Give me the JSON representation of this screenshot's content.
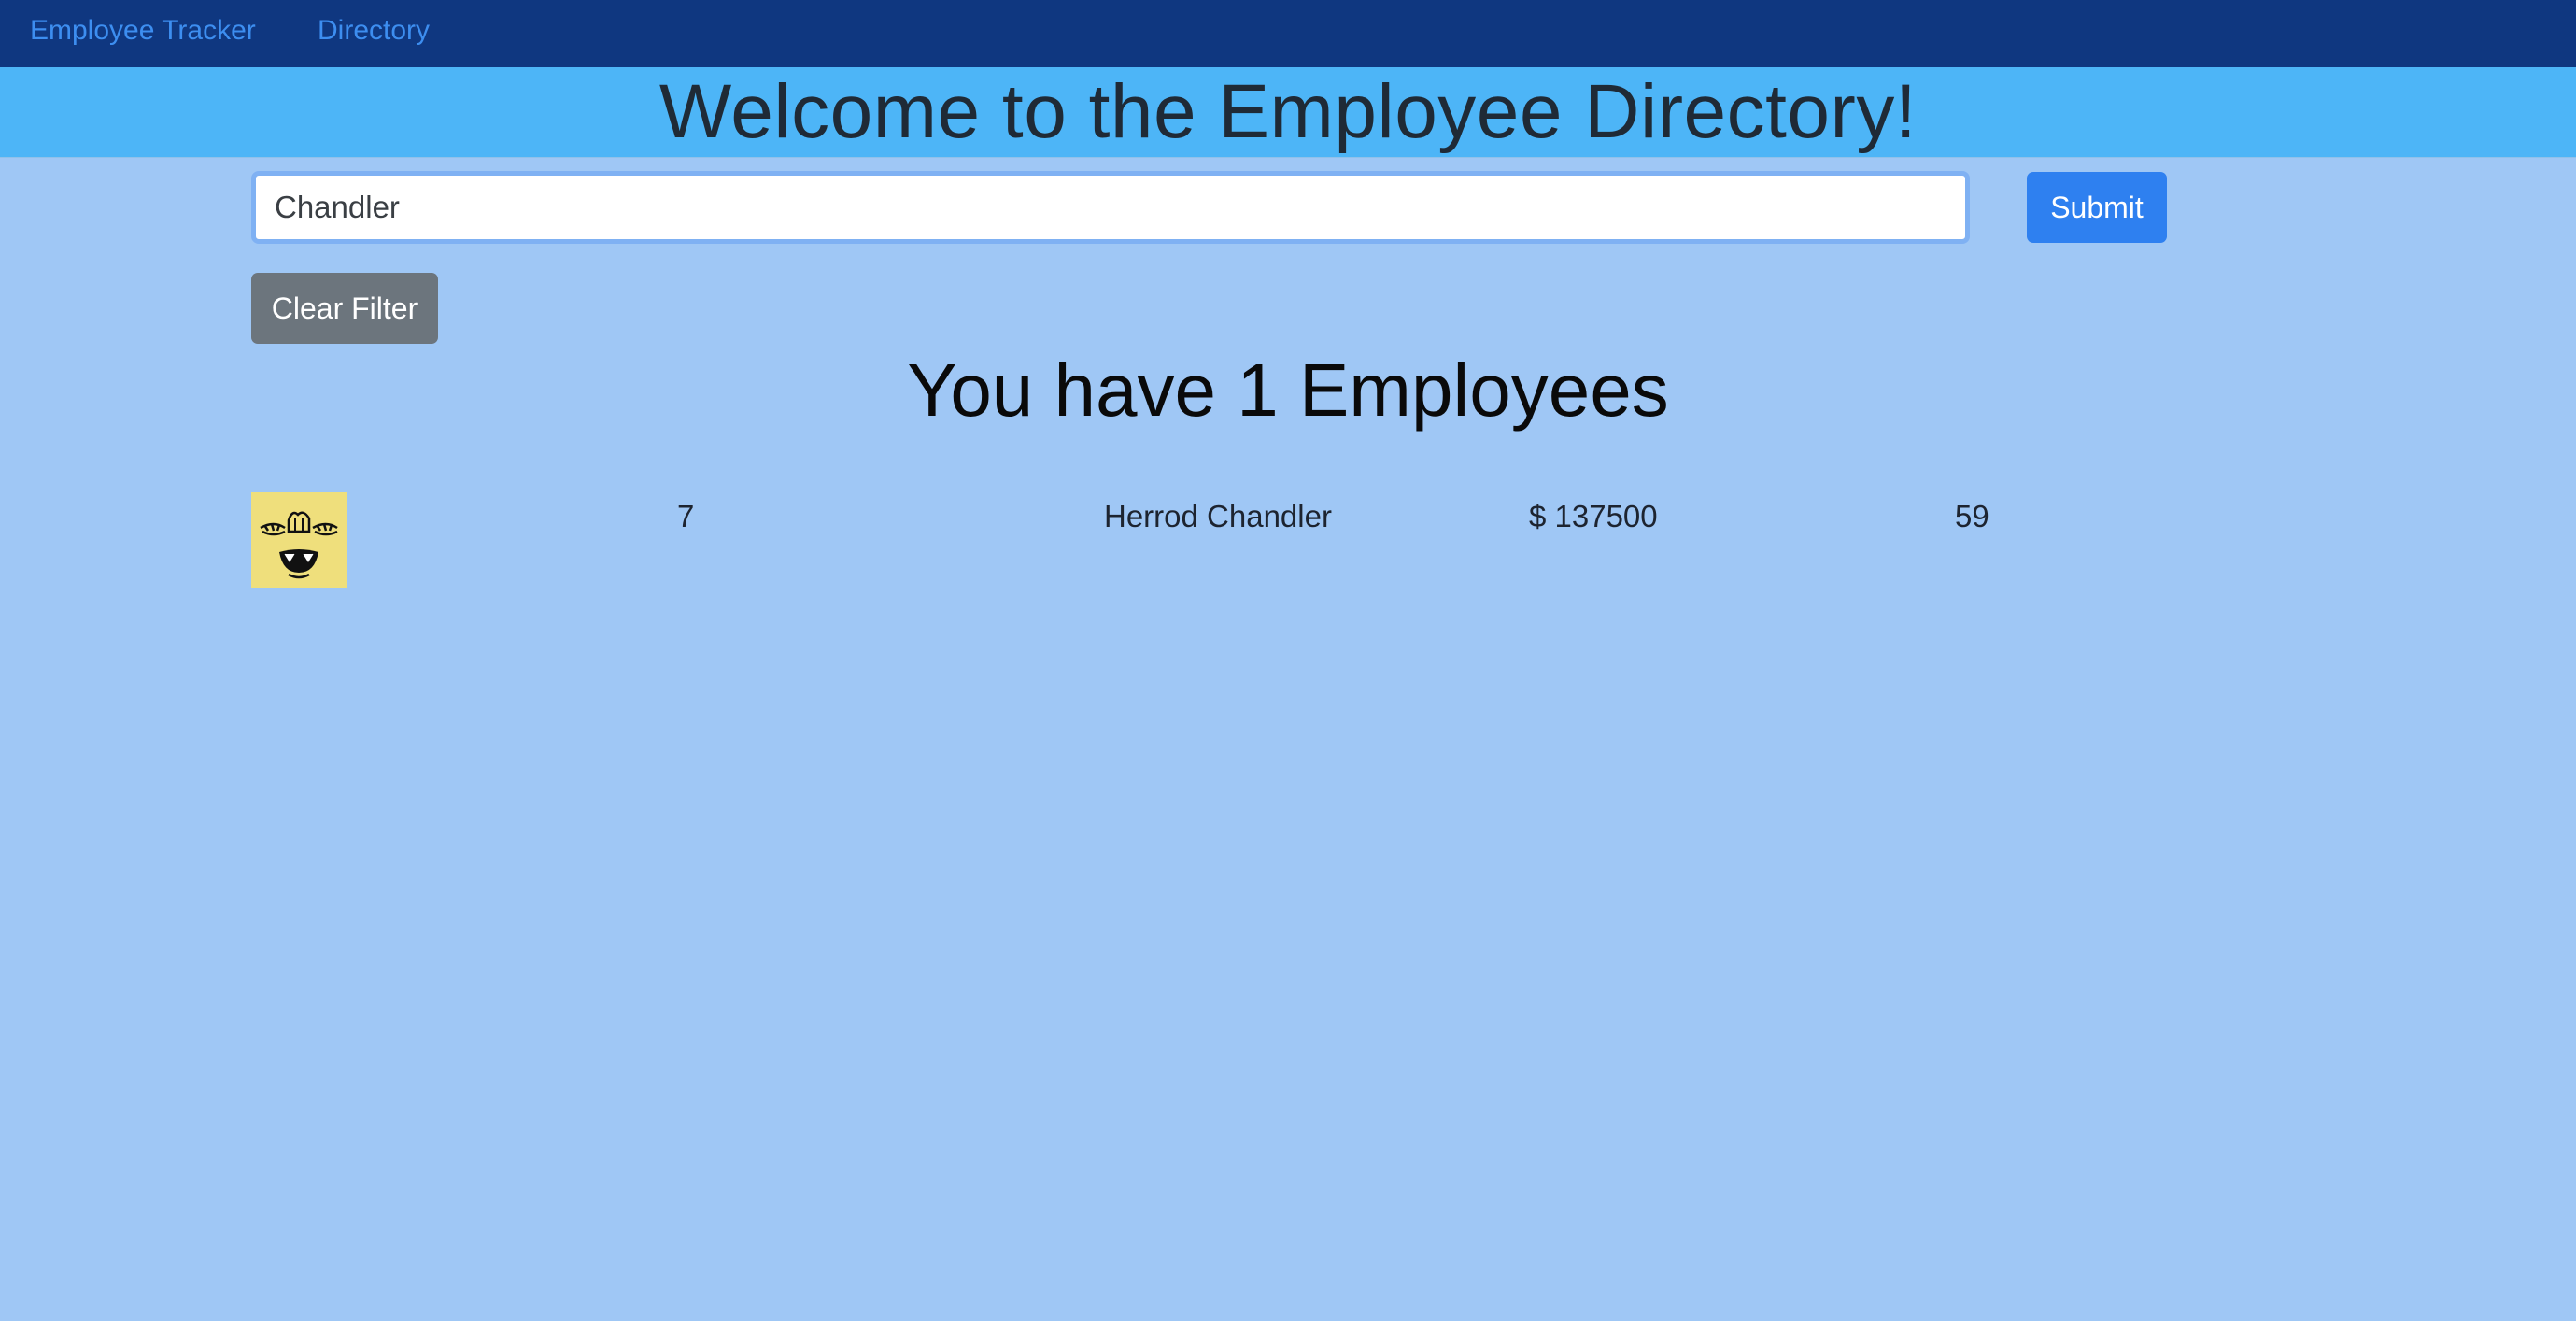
{
  "nav": {
    "brand": "Employee Tracker",
    "directory": "Directory"
  },
  "header": {
    "title": "Welcome to the Employee Directory!"
  },
  "search": {
    "value": "Chandler",
    "submit_label": "Submit",
    "clear_label": "Clear Filter"
  },
  "summary": {
    "heading": "You have 1 Employees"
  },
  "employees": [
    {
      "id": "7",
      "name": "Herrod Chandler",
      "salary": "$ 137500",
      "age": "59",
      "avatar_icon": "cartoon-face-icon"
    }
  ],
  "colors": {
    "navbar": "#0f3780",
    "banner": "#4db5f7",
    "page_background": "#9fc7f5",
    "link": "#3d8ef0",
    "submit_button": "#2e80f0",
    "clear_button": "#6c757d"
  }
}
